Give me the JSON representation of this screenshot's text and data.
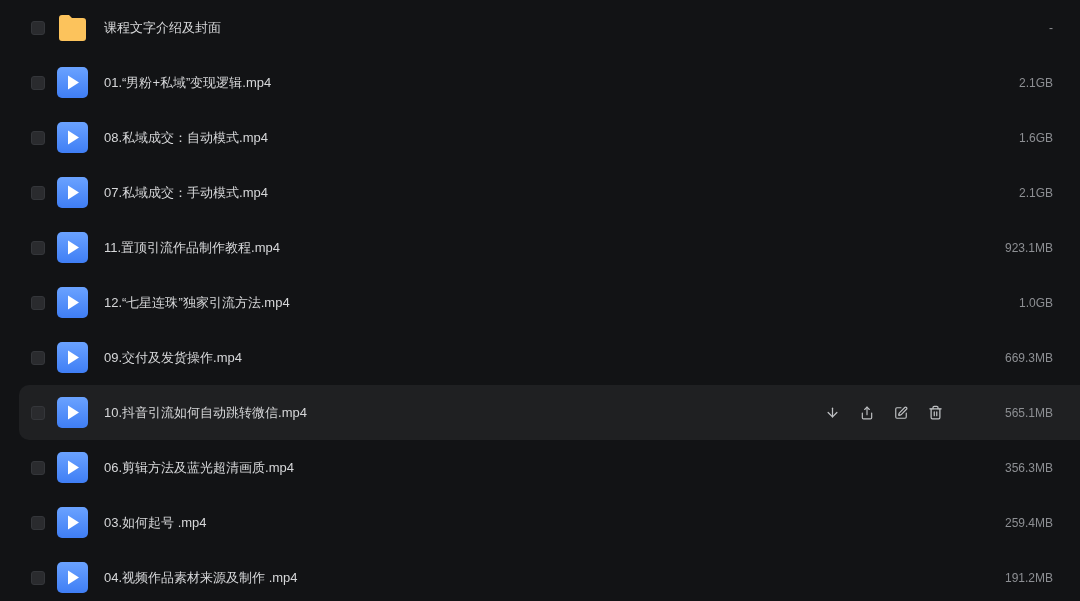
{
  "files": [
    {
      "kind": "folder",
      "name": "课程文字介绍及封面",
      "size": "-",
      "checked": false,
      "hovered": false
    },
    {
      "kind": "video",
      "name": "01.“男粉+私域”变现逻辑.mp4",
      "size": "2.1GB",
      "checked": false,
      "hovered": false
    },
    {
      "kind": "video",
      "name": "08.私域成交：自动模式.mp4",
      "size": "1.6GB",
      "checked": false,
      "hovered": false
    },
    {
      "kind": "video",
      "name": "07.私域成交：手动模式.mp4",
      "size": "2.1GB",
      "checked": false,
      "hovered": false
    },
    {
      "kind": "video",
      "name": "11.置顶引流作品制作教程.mp4",
      "size": "923.1MB",
      "checked": false,
      "hovered": false
    },
    {
      "kind": "video",
      "name": "12.“七星连珠”独家引流方法.mp4",
      "size": "1.0GB",
      "checked": false,
      "hovered": false
    },
    {
      "kind": "video",
      "name": "09.交付及发货操作.mp4",
      "size": "669.3MB",
      "checked": false,
      "hovered": false
    },
    {
      "kind": "video",
      "name": "10.抖音引流如何自动跳转微信.mp4",
      "size": "565.1MB",
      "checked": false,
      "hovered": true
    },
    {
      "kind": "video",
      "name": "06.剪辑方法及蓝光超清画质.mp4",
      "size": "356.3MB",
      "checked": false,
      "hovered": false
    },
    {
      "kind": "video",
      "name": "03.如何起号 .mp4",
      "size": "259.4MB",
      "checked": false,
      "hovered": false
    },
    {
      "kind": "video",
      "name": "04.视频作品素材来源及制作 .mp4",
      "size": "191.2MB",
      "checked": false,
      "hovered": false
    }
  ]
}
